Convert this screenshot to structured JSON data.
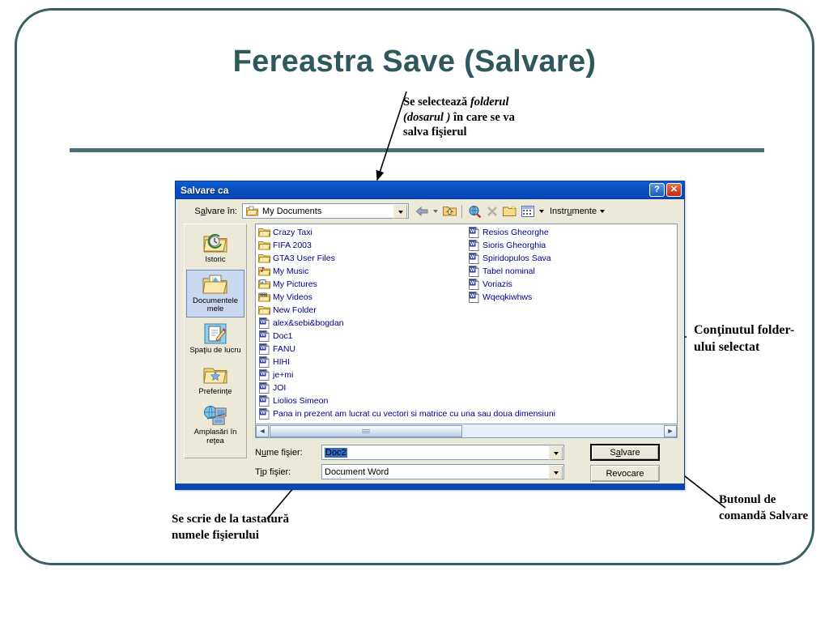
{
  "slide": {
    "title": "Fereastra Save (Salvare)",
    "annotations": {
      "folder": {
        "line1_a": "Se selectează ",
        "line1_i": "folderul",
        "line2_i": "(dosarul )",
        "line2_b": " în care se va",
        "line3": "salva fişierul"
      },
      "content": "Conţinutul folder-ului selectat",
      "button": "Butonul de comandă Salvare",
      "filename": "Se scrie de la tastatură numele fişierului"
    },
    "accent_color": "#3a5f63",
    "title_color": "#2f585c"
  },
  "dialog": {
    "title": "Salvare ca",
    "titlebar_color": "#0a4fc0",
    "help_button": "?",
    "close_button": "✕",
    "lookin": {
      "label_pre": "S",
      "label_underlined": "a",
      "label_post": "lvare în:",
      "value": "My Documents",
      "icon": "folder-documents-icon"
    },
    "toolbar": {
      "back": "back-arrow-icon",
      "back_caret": "chevron-down-icon",
      "up": "up-one-level-icon",
      "search": "search-web-icon",
      "delete": "delete-x-icon",
      "new_folder": "new-folder-icon",
      "views": "views-icon",
      "views_caret": "chevron-down-icon",
      "tools_label_pre": "Instr",
      "tools_label_underlined": "u",
      "tools_label_post": "mente"
    },
    "places": [
      {
        "label": "Istoric",
        "icon": "history-folder-icon",
        "selected": false
      },
      {
        "label": "Documentele mele",
        "icon": "my-documents-icon",
        "selected": true
      },
      {
        "label": "Spaţiu de lucru",
        "icon": "desktop-workspace-icon",
        "selected": false
      },
      {
        "label": "Preferinţe",
        "icon": "favorites-folder-icon",
        "selected": false
      },
      {
        "label": "Amplasări în reţea",
        "icon": "network-places-icon",
        "selected": false
      }
    ],
    "files": [
      {
        "name": "Crazy Taxi",
        "icon": "folder-icon"
      },
      {
        "name": "FIFA 2003",
        "icon": "folder-icon"
      },
      {
        "name": "GTA3 User Files",
        "icon": "folder-icon"
      },
      {
        "name": "My Music",
        "icon": "music-folder-icon"
      },
      {
        "name": "My Pictures",
        "icon": "pictures-folder-icon"
      },
      {
        "name": "My Videos",
        "icon": "videos-folder-icon"
      },
      {
        "name": "New Folder",
        "icon": "folder-icon"
      },
      {
        "name": "alex&sebi&bogdan",
        "icon": "word-document-icon"
      },
      {
        "name": "Doc1",
        "icon": "word-document-icon"
      },
      {
        "name": "FANU",
        "icon": "word-document-icon"
      },
      {
        "name": "HIHI",
        "icon": "word-document-icon"
      },
      {
        "name": "je+mi",
        "icon": "word-document-icon"
      },
      {
        "name": "JOI",
        "icon": "word-document-icon"
      },
      {
        "name": "Liolios Simeon",
        "icon": "word-document-icon"
      },
      {
        "name": "Pana in prezent am lucrat cu vectori si matrice cu una sau doua dimensiuni",
        "icon": "word-document-icon"
      },
      {
        "name": "Resios Gheorghe",
        "icon": "word-document-icon"
      },
      {
        "name": "Sioris Gheorghia",
        "icon": "word-document-icon"
      },
      {
        "name": "Spiridopulos Sava",
        "icon": "word-document-icon"
      },
      {
        "name": "Tabel nominal",
        "icon": "word-document-icon"
      },
      {
        "name": "Voriazis",
        "icon": "word-document-icon"
      },
      {
        "name": "Wqeqkiwhws",
        "icon": "word-document-icon"
      }
    ],
    "scrollbar": {
      "left_arrow": "◄",
      "right_arrow": "►"
    },
    "filename_field": {
      "label_pre": "N",
      "label_underlined": "u",
      "label_post": "me fişier:",
      "value": "Doc2",
      "selected": true
    },
    "filetype_field": {
      "label_pre": "T",
      "label_underlined": "i",
      "label_post": "p fişier:",
      "value": "Document Word"
    },
    "buttons": {
      "save_pre": "S",
      "save_underlined": "a",
      "save_post": "lvare",
      "cancel": "Revocare"
    }
  }
}
